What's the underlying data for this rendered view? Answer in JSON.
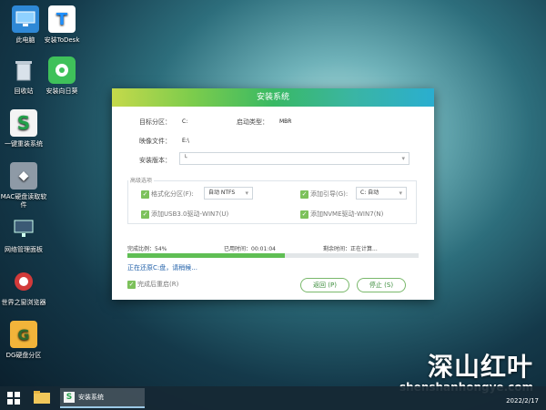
{
  "desktop": {
    "icons": [
      {
        "label": "此电脑"
      },
      {
        "label": "安装ToDesk"
      },
      {
        "label": "回收站"
      },
      {
        "label": "安装向日葵"
      },
      {
        "label": "一键重装系统"
      },
      {
        "label": "MAC硬盘读取软件"
      },
      {
        "label": "网络管理面板"
      },
      {
        "label": "世界之窗浏览器"
      },
      {
        "label": "DG硬盘分区"
      }
    ]
  },
  "installer": {
    "title": "安装系统",
    "target_partition_label": "目标分区：",
    "target_partition_value": "C:",
    "boot_type_label": "启动类型：",
    "boot_type_value": "MBR",
    "image_file_label": "映像文件：",
    "image_file_value": "E:\\",
    "install_version_label": "安装版本：",
    "install_version_value": "└",
    "advanced_legend": "高级选项",
    "format_partition_label": "格式化分区(F):",
    "format_partition_value": "自动 NTFS",
    "add_boot_label": "添加引导(G):",
    "add_boot_value": "C: 自动",
    "usb3_label": "添加USB3.0驱动-WIN7(U)",
    "nvme_label": "添加NVME驱动-WIN7(N)",
    "progress_label": "完成比例：54%",
    "progress_fraction": 0.54,
    "elapsed_label": "已用时间：00:01:04",
    "remaining_label": "剩余时间：正在计算...",
    "status_text": "正在还原C:盘，请稍候...",
    "restart_label": "完成后重启(R)",
    "back_button": "返回 (P)",
    "stop_button": "停止 (S)",
    "accent_color": "#39b964"
  },
  "taskbar": {
    "active_app": "安装系统",
    "date": "2022/2/17"
  },
  "watermark": {
    "title": "深山红叶",
    "url": "shenshanhongye.com"
  }
}
